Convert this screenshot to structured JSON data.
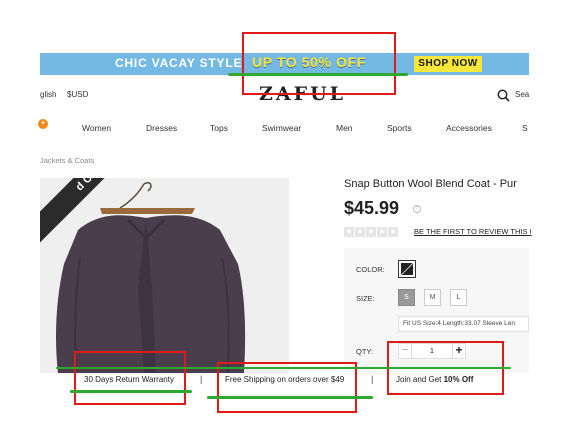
{
  "promo": {
    "left_text": "CHIC VACAY STYLE",
    "mid_text": "UP TO 50% OFF",
    "button_label": "SHOP NOW",
    "bg_color": "#74b9e4",
    "accent_color": "#f7e73a"
  },
  "header": {
    "language": "glish",
    "currency": "$USD",
    "logo": "ZAFUL",
    "search_label": "Sea"
  },
  "nav": {
    "badge": "+",
    "items": [
      "Women",
      "Dresses",
      "Tops",
      "Swimwear",
      "Men",
      "Sports",
      "Accessories",
      "S"
    ]
  },
  "breadcrumb": "Jackets & Coats",
  "product": {
    "ribbon": "d Out",
    "title": "Snap Button Wool Blend Coat - Pur",
    "price": "$45.99",
    "price_info_icon": "?",
    "review_link": "BE THE FIRST TO REVIEW THIS I",
    "star_count": 5,
    "color_label": "COLOR:",
    "size_label": "SIZE:",
    "sizes": [
      "S",
      "M",
      "L"
    ],
    "selected_size": "S",
    "size_info": "Fit US Size:4  Length:33.07  Sleeve Len",
    "qty_label": "QTY:",
    "qty_value": "1",
    "qty_minus": "−",
    "qty_plus": "+"
  },
  "benefits": {
    "warranty": "30 Days Return Warranty",
    "shipping": "Free Shipping on orders over $49",
    "join_prefix": "Join and Get ",
    "join_bold": "10% Off",
    "separator": "|"
  }
}
